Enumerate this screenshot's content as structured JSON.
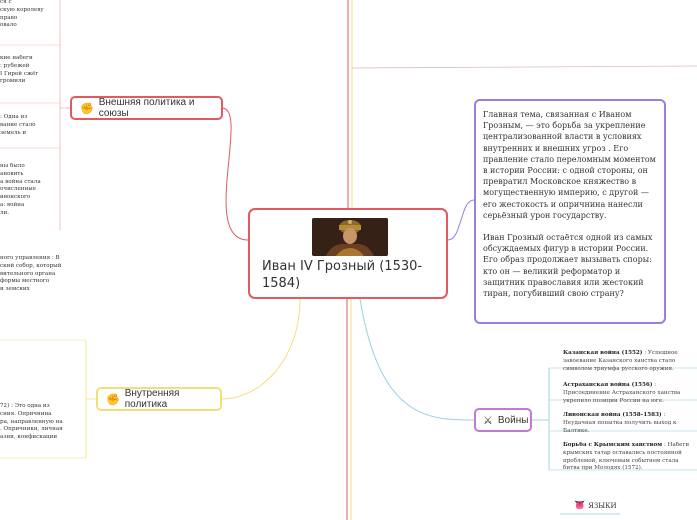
{
  "center": {
    "title": "Иван IV Грозный (1530-1584)"
  },
  "summary": {
    "p1": "Главная тема, связанная с Иваном Грозным, — это борьба за укрепление централизованной власти в условиях внутренних и внешних угроз . Его правление стало переломным моментом в истории России: с одной стороны, он превратил Московское княжество в могущественную империю, с другой — его жестокость и опричнина нанесли серьёзный урон государству.",
    "p2": "Иван Грозный остаётся одной из самых обсуждаемых фигур в истории России. Его образ продолжает вызывать споры: кто он — великий реформатор и защитник православия или жестокий тиран, погубивший свою страну?"
  },
  "branches": {
    "foreign": {
      "label": "Внешняя политика и союзы",
      "icon": "fist-icon"
    },
    "domestic": {
      "label": "Внутренняя политика",
      "icon": "fist-icon"
    },
    "wars": {
      "label": "Войны",
      "icon": "crossed-swords-icon"
    },
    "languages": {
      "label": "ЯЗЫКИ",
      "icon": "tongue-icon"
    }
  },
  "wars": [
    {
      "title": "Казанская война (1552)",
      "text": " : Успешное завоевание Казанского ханства стало символом триумфа русского оружия."
    },
    {
      "title": "Астраханская война (1556)",
      "text": " : Присоединение Астраханского ханства укрепило позиции России на юге."
    },
    {
      "title": "Ливонская война (1558–1583)",
      "text": " : Неудачная попытка получить выход к Балтике."
    },
    {
      "title": "Борьба с Крымским ханством",
      "text": " : Набеги крымских татар оставались постоянной проблемой, ключевым событием стала битва при Молодях (1572)."
    }
  ],
  "left_snippets": {
    "s1": "ся с\nскую королеву\nправо\nовало",
    "s2": "кие набеги\n: рубежей\nI Гирей сжёг\nгромили",
    "s3": ": Одна из\nвание стало\nземель и",
    "s4": "ны было\nановить\nа война стала\nочисленные\nивонского\nа: война\nли.",
    "s5": "ного управления : В\nский собор, который\nвительного органа\nформы местного\nи земских",
    "s6": "72) : Это одна из\nсния. Опричнина\nра, направленную на\n. Опричники, личная\nазни, конфискации"
  },
  "colors": {
    "center_border": "#e25a60",
    "summary_border": "#9b7ee0",
    "foreign_border": "#e25a60",
    "domestic_border": "#f0e07a",
    "wars_border": "#c07ad6",
    "link_wars": "#8ec9e0"
  }
}
